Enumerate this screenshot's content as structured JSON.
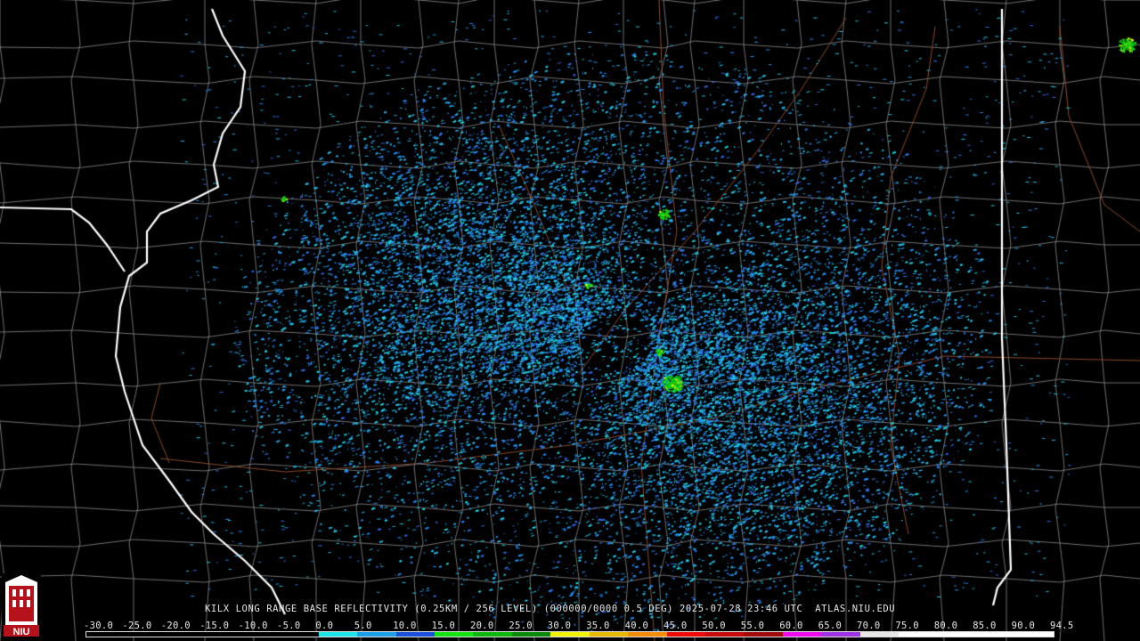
{
  "caption": "KILX LONG RANGE BASE REFLECTIVITY (0.25KM / 256 LEVEL) (000000/0000 0.5 DEG) 2025-07-28 23:46 UTC  ATLAS.NIU.EDU",
  "logo_text": "NIU",
  "colorbar": {
    "labels": [
      "-30.0",
      "-25.0",
      "-20.0",
      "-15.0",
      "-10.0",
      "-5.0",
      "0.0",
      "5.0",
      "10.0",
      "15.0",
      "20.0",
      "25.0",
      "30.0",
      "35.0",
      "40.0",
      "45.0",
      "50.0",
      "55.0",
      "60.0",
      "65.0",
      "70.0",
      "75.0",
      "80.0",
      "85.0",
      "90.0",
      "94.5"
    ],
    "colors": [
      "#000000",
      "#000000",
      "#000000",
      "#000000",
      "#000000",
      "#000000",
      "#1ee3e8",
      "#1c9fe6",
      "#1a4fe0",
      "#14e314",
      "#0fb80f",
      "#0a8a0a",
      "#f2f20a",
      "#e6b800",
      "#f58c0a",
      "#f00a0a",
      "#c80a0a",
      "#a00a0a",
      "#f00af0",
      "#a032e6",
      "#e6e6e6",
      "#ffffff",
      "#ffffff",
      "#ffffff",
      "#ffffff"
    ]
  },
  "map": {
    "radar_site": "KILX",
    "echo_colors": [
      "#1fb8e8",
      "#23c7ea",
      "#1fa3e2",
      "#2a7fe6",
      "#1e90ff",
      "#3366e0",
      "#1ad2e0"
    ],
    "strong_echo_colors": [
      "#14e314",
      "#0fb80f",
      "#f2f20a"
    ],
    "state_line_color": "#ffffff",
    "county_line_color": "#8c8c8c",
    "highway_color": "#8b4a2a"
  }
}
